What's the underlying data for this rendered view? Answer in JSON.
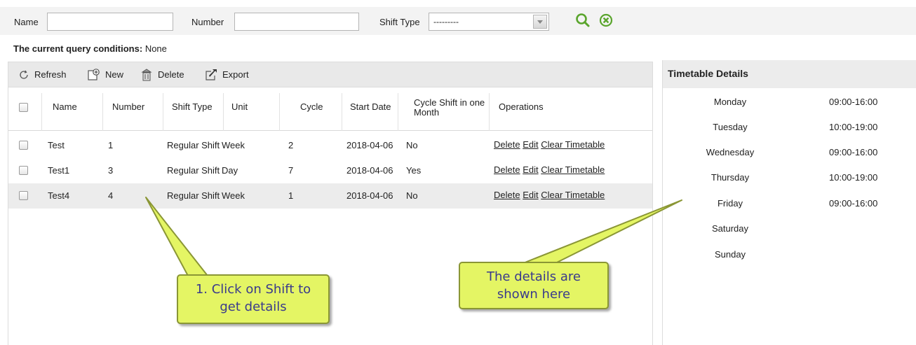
{
  "query": {
    "name_label": "Name",
    "name_value": "",
    "number_label": "Number",
    "number_value": "",
    "shift_type_label": "Shift Type",
    "shift_type_value": "---------"
  },
  "conditions": {
    "label": "The current query conditions:",
    "value": "None"
  },
  "toolbar": {
    "refresh": "Refresh",
    "new": "New",
    "delete": "Delete",
    "export": "Export"
  },
  "table": {
    "columns": [
      "Name",
      "Number",
      "Shift Type",
      "Unit",
      "Cycle",
      "Start Date",
      "Cycle Shift in one Month",
      "Operations"
    ],
    "rows": [
      {
        "name": "Test",
        "number": "1",
        "shift_type": "Regular Shift",
        "unit": "Week",
        "cycle": "2",
        "start_date": "2018-04-06",
        "cycle_shift": "No",
        "op_delete": "Delete",
        "op_edit": "Edit",
        "op_clear": "Clear Timetable"
      },
      {
        "name": "Test1",
        "number": "3",
        "shift_type": "Regular Shift",
        "unit": "Day",
        "cycle": "7",
        "start_date": "2018-04-06",
        "cycle_shift": "Yes",
        "op_delete": "Delete",
        "op_edit": "Edit",
        "op_clear": "Clear Timetable"
      },
      {
        "name": "Test4",
        "number": "4",
        "shift_type": "Regular Shift",
        "unit": "Week",
        "cycle": "1",
        "start_date": "2018-04-06",
        "cycle_shift": "No",
        "op_delete": "Delete",
        "op_edit": "Edit",
        "op_clear": "Clear Timetable"
      }
    ]
  },
  "details": {
    "title": "Timetable Details",
    "days": [
      {
        "day": "Monday",
        "time": "09:00-16:00"
      },
      {
        "day": "Tuesday",
        "time": "10:00-19:00"
      },
      {
        "day": "Wednesday",
        "time": "09:00-16:00"
      },
      {
        "day": "Thursday",
        "time": "10:00-19:00"
      },
      {
        "day": "Friday",
        "time": "09:00-16:00"
      },
      {
        "day": "Saturday",
        "time": ""
      },
      {
        "day": "Sunday",
        "time": ""
      }
    ]
  },
  "callouts": {
    "left_line1": "1. Click on Shift to",
    "left_line2": "get details",
    "right_line1": "The details are",
    "right_line2": "shown here"
  },
  "colors": {
    "search_icon": "#5aa52d",
    "clear_icon": "#5aa52d",
    "callout_fill": "#e4f564",
    "callout_text": "#3a3a8c"
  }
}
